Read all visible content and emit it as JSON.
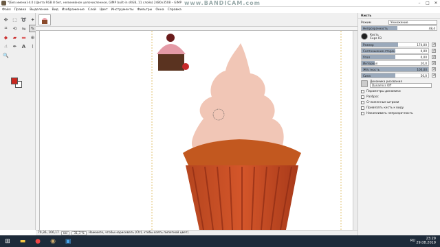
{
  "window": {
    "title": "*[Без имени]-4.0 (Цвета RGB 8 бит, нелинейное целочисленное, GIMP built-in sRGB, 11 слоёв) 2480x3508 – GIMP",
    "watermark": "www.BANDICAM.com"
  },
  "menu": [
    "Файл",
    "Правка",
    "Выделение",
    "Вид",
    "Изображение",
    "Слой",
    "Цвет",
    "Инструменты",
    "Фильтры",
    "Окна",
    "Справка"
  ],
  "toolbox": {
    "tools": [
      "move-tool-icon",
      "rect-select-icon",
      "lasso-icon",
      "fuzzy-select-icon",
      "crop-icon",
      "transform-icon",
      "flip-icon",
      "paintbrush-icon",
      "bucket-icon",
      "gradient-icon",
      "eraser-icon",
      "clone-icon",
      "smudge-icon",
      "path-icon",
      "text-icon",
      "color-picker-icon",
      "zoom-icon"
    ],
    "foreground_color": "#c8281f",
    "background_color": "#ffffff"
  },
  "status": {
    "coords": "70,36, 106,17",
    "unit": "мм",
    "zoom": "31,3 %",
    "message": "Нажмите, чтобы нарисовать (Ctrl, чтобы взять пипеткой цвет)"
  },
  "panel": {
    "title": "Кисть",
    "mode_label": "Режим",
    "mode_value": "Умножение",
    "opacity_label": "Непрозрачность",
    "opacity_value": "48,4",
    "brush_label": "Кисть",
    "brush_name": "Cups 03",
    "sliders": [
      {
        "label": "Размер",
        "value": "174,00",
        "fill": 0.55
      },
      {
        "label": "Соотношение сторон",
        "value": "0,00",
        "fill": 0.5
      },
      {
        "label": "Угол",
        "value": "0,00",
        "fill": 0.5
      },
      {
        "label": "Интервал",
        "value": "20,0",
        "fill": 0.2
      },
      {
        "label": "Жёсткость",
        "value": "100,00",
        "fill": 1.0
      },
      {
        "label": "Сила",
        "value": "50,0",
        "fill": 0.5
      }
    ],
    "dynamics_label": "Динамика рисования",
    "dynamics_value": "Dynamics Off",
    "options": [
      "Параметры динамики",
      "Разброс",
      "Сглаженные штрихи",
      "Привязать кисть к виду",
      "Накапливать непрозрачность"
    ]
  },
  "taskbar": {
    "lang": "RU",
    "time": "23:29",
    "date": "29.08.2019"
  }
}
